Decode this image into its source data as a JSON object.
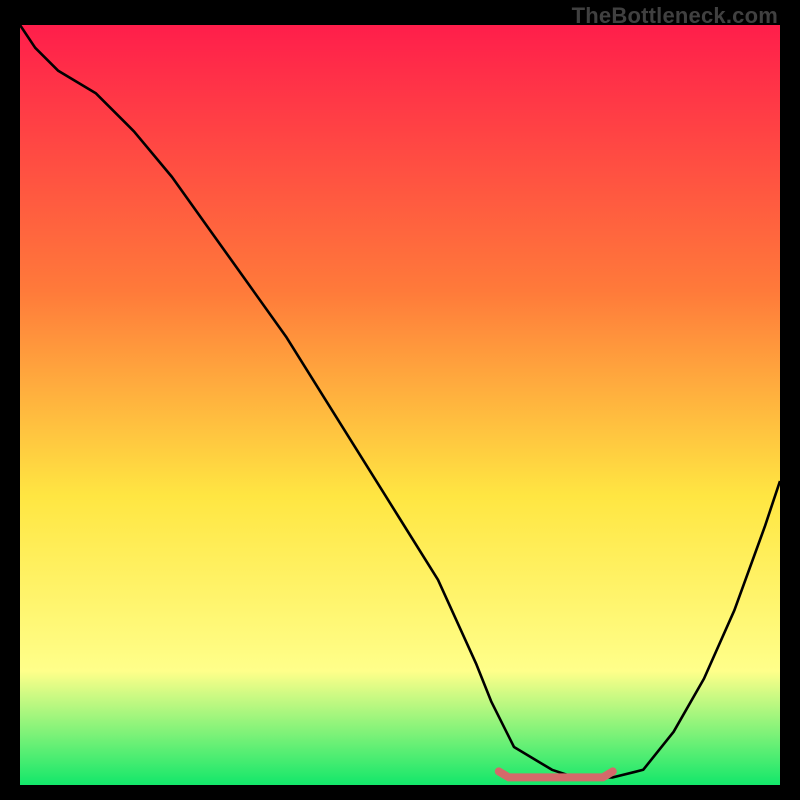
{
  "watermark": "TheBottleneck.com",
  "colors": {
    "background": "#000000",
    "gradient_top": "#ff1e4b",
    "gradient_mid1": "#ff7a3a",
    "gradient_mid2": "#ffe642",
    "gradient_mid3": "#ffff8a",
    "gradient_bottom": "#13e76a",
    "curve": "#000000",
    "segment": "#d46a6a"
  },
  "chart_data": {
    "type": "line",
    "title": "",
    "xlabel": "",
    "ylabel": "",
    "xlim": [
      0,
      100
    ],
    "ylim": [
      0,
      100
    ],
    "x": [
      0,
      2,
      5,
      10,
      15,
      20,
      25,
      30,
      35,
      40,
      45,
      50,
      55,
      60,
      62,
      65,
      70,
      73,
      78,
      82,
      86,
      90,
      94,
      98,
      100
    ],
    "values": [
      100,
      97,
      94,
      91,
      86,
      80,
      73,
      66,
      59,
      51,
      43,
      35,
      27,
      16,
      11,
      5,
      2,
      1,
      1,
      2,
      7,
      14,
      23,
      34,
      40
    ],
    "highlight_segment": {
      "x_start": 63,
      "x_end": 78,
      "y": 1
    }
  }
}
